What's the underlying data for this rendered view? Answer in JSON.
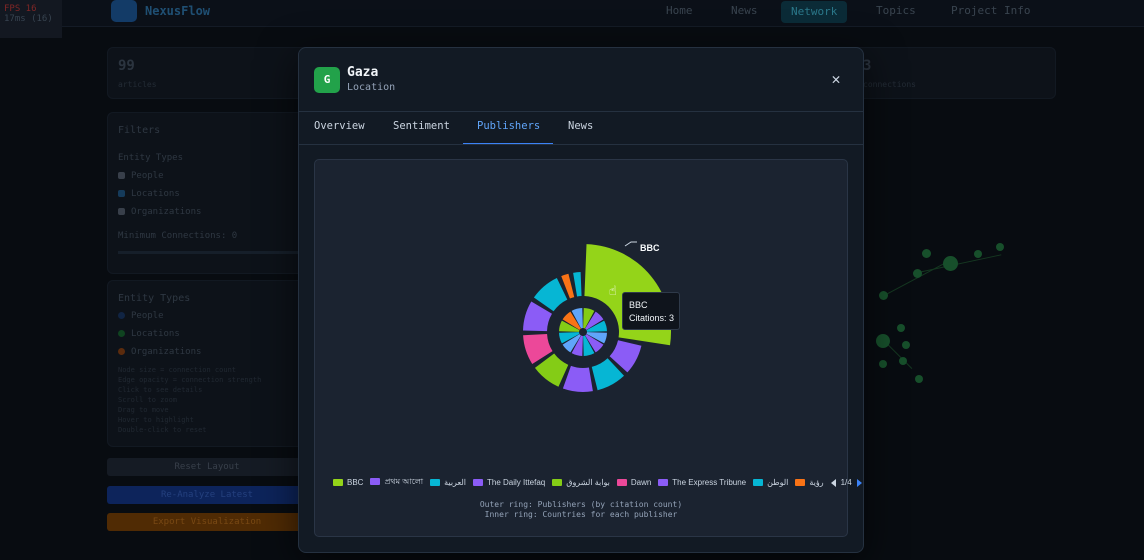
{
  "app": {
    "brand": "NexusFlow",
    "fps_label": "FPS 16",
    "fps_sub": "17ms (16)",
    "nav": [
      "Home",
      "News",
      "Network",
      "Topics",
      "Project Info"
    ],
    "active_nav": "Network"
  },
  "background": {
    "stat_left_value": "99",
    "stat_left_label": "articles",
    "stat_right_value": "3",
    "stat_right_label": "connections",
    "filters_title": "Filters",
    "entity_types_label": "Entity Types",
    "filter_items": [
      "People",
      "Locations",
      "Organizations"
    ],
    "min_connections": "Minimum Connections: 0",
    "legend_title": "Entity Types",
    "legend_items": [
      "People",
      "Locations",
      "Organizations"
    ],
    "legend_colors": [
      "#2563eb",
      "#22a24a",
      "#f97316"
    ],
    "hints": [
      "Node size = connection count",
      "Edge opacity = connection strength",
      "Click to see details",
      "Scroll to zoom",
      "Drag to move",
      "Hover to highlight",
      "Double-click to reset"
    ],
    "btn_reset": "Reset Layout",
    "btn_reload": "Re-Analyze Latest",
    "btn_export": "Export Visualization"
  },
  "modal": {
    "avatar_letter": "G",
    "title": "Gaza",
    "subtitle": "Location",
    "tabs": [
      "Overview",
      "Sentiment",
      "Publishers",
      "News"
    ],
    "active_tab": "Publishers",
    "tooltip_name": "BBC",
    "tooltip_value": "Citations: 3",
    "highlight_label": "BBC",
    "pager": "1/4",
    "note_outer": "Outer ring: Publishers (by citation count)",
    "note_inner": "Inner ring: Countries for each publisher"
  },
  "chart_data": {
    "type": "pie",
    "variant": "sunburst",
    "outer_ring": [
      {
        "name": "BBC",
        "value": 3,
        "color": "#94d419",
        "highlighted": true
      },
      {
        "name": "প্রথম আলো",
        "value": 1,
        "color": "#8b5cf6"
      },
      {
        "name": "العربية",
        "value": 1,
        "color": "#06b6d4"
      },
      {
        "name": "The Daily Ittefaq",
        "value": 1,
        "color": "#8b5cf6"
      },
      {
        "name": "بوابة الشروق",
        "value": 1,
        "color": "#84cc16"
      },
      {
        "name": "Dawn",
        "value": 1,
        "color": "#ec4899"
      },
      {
        "name": "The Express Tribune",
        "value": 1,
        "color": "#8b5cf6"
      },
      {
        "name": "الوطن",
        "value": 1,
        "color": "#06b6d4"
      },
      {
        "name": "رؤية",
        "value": 0.35,
        "color": "#f97316"
      },
      {
        "name": "",
        "value": 0.35,
        "color": "#06b6d4"
      }
    ],
    "legend": [
      {
        "name": "BBC",
        "color": "#94d419"
      },
      {
        "name": "প্রথম আলো",
        "color": "#8b5cf6"
      },
      {
        "name": "العربية",
        "color": "#06b6d4"
      },
      {
        "name": "The Daily Ittefaq",
        "color": "#8b5cf6"
      },
      {
        "name": "بوابة الشروق",
        "color": "#84cc16"
      },
      {
        "name": "Dawn",
        "color": "#ec4899"
      },
      {
        "name": "The Express Tribune",
        "color": "#8b5cf6"
      },
      {
        "name": "الوطن",
        "color": "#06b6d4"
      },
      {
        "name": "رؤية",
        "color": "#f97316"
      }
    ],
    "inner_ring_colors": [
      "#84cc16",
      "#8b5cf6",
      "#06b6d4",
      "#60a5fa",
      "#8b5cf6",
      "#06b6d4",
      "#8b5cf6",
      "#60a5fa",
      "#06b6d4",
      "#84cc16",
      "#f97316",
      "#60a5fa"
    ],
    "colors": {
      "panel": "#1b2330",
      "accent": "#3b82f6"
    }
  }
}
